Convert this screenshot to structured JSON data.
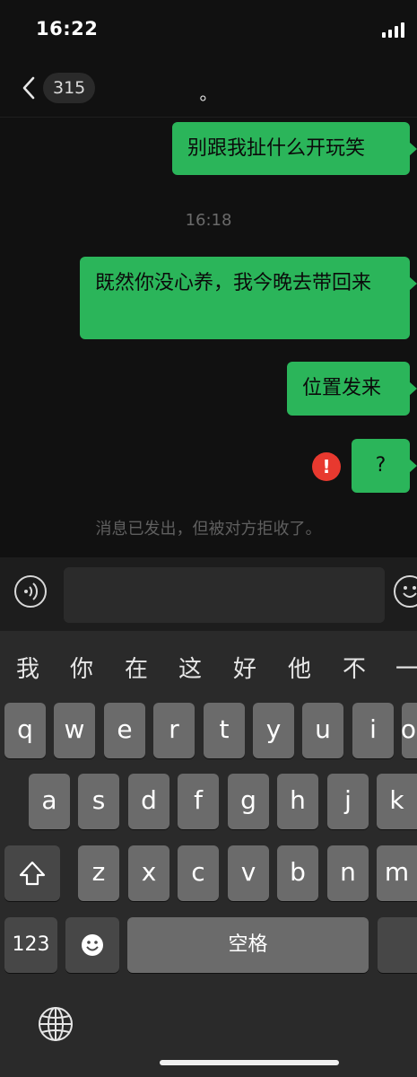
{
  "status_bar": {
    "time": "16:22"
  },
  "nav": {
    "back_count": "315",
    "title": "。"
  },
  "messages": [
    {
      "text": "别跟我扯什么开玩笑"
    },
    {
      "timestamp": "16:18"
    },
    {
      "text": "既然你没心养，我今晚去带回来"
    },
    {
      "text": "位置发来"
    },
    {
      "text": "?",
      "error_mark": "!"
    }
  ],
  "system_notice": "消息已发出，但被对方拒收了。",
  "input": {
    "value": ""
  },
  "keyboard": {
    "candidates": [
      "我",
      "你",
      "在",
      "这",
      "好",
      "他",
      "不",
      "一"
    ],
    "row1": [
      "q",
      "w",
      "e",
      "r",
      "t",
      "y",
      "u",
      "i",
      "o"
    ],
    "row2": [
      "a",
      "s",
      "d",
      "f",
      "g",
      "h",
      "j",
      "k"
    ],
    "row3": [
      "z",
      "x",
      "c",
      "v",
      "b",
      "n",
      "m"
    ],
    "numbers_label": "123",
    "space_label": "空格"
  },
  "icons": {
    "back": "chevron-left-icon",
    "voice": "voice-icon",
    "emoji": "emoji-icon",
    "shift": "shift-icon",
    "globe": "globe-icon"
  },
  "colors": {
    "bubble": "#2bb55a",
    "error": "#e8392f",
    "background": "#111111"
  }
}
